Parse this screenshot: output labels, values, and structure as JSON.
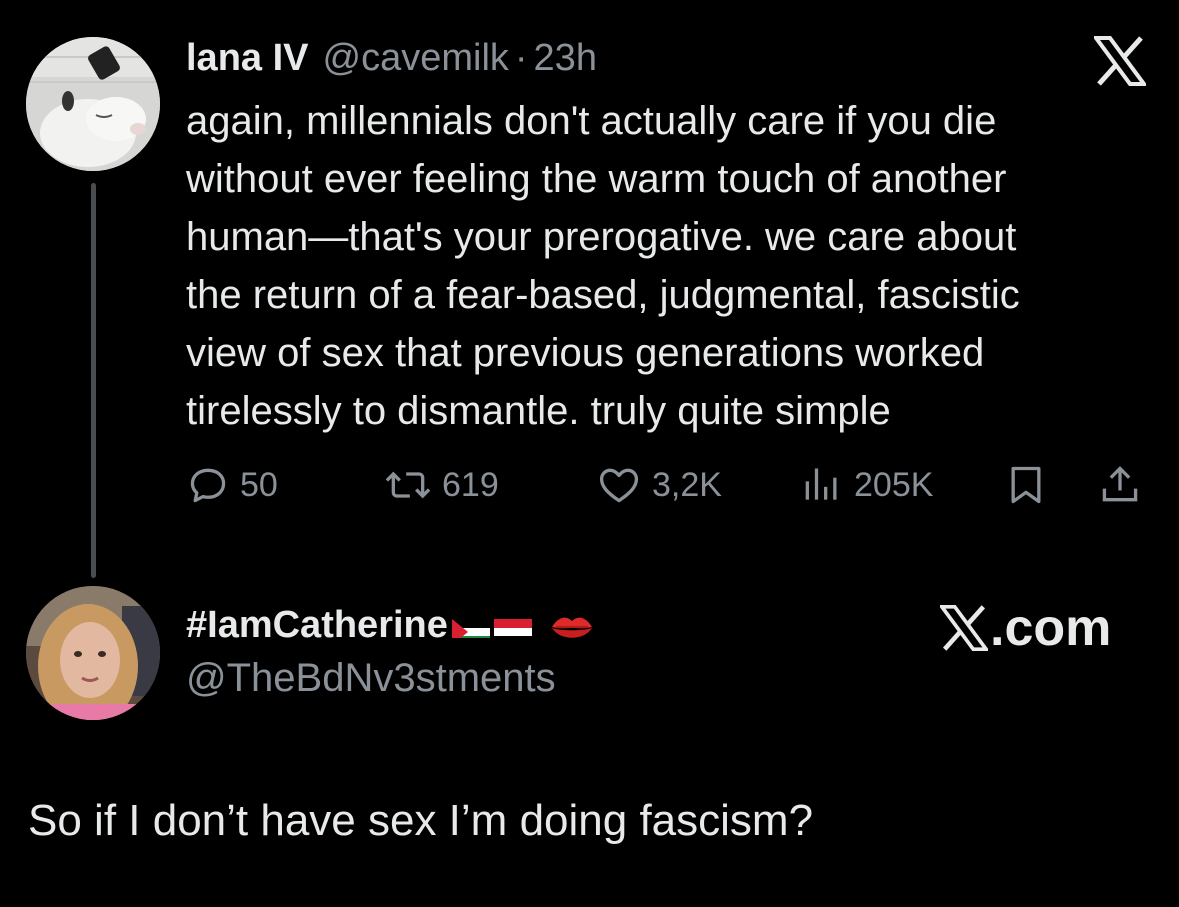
{
  "tweet1": {
    "display_name": "lana IV",
    "handle": "@cavemilk",
    "separator": "·",
    "time": "23h",
    "text": "again, millennials don't actually care if you die\nwithout ever feeling the warm touch of another\nhuman—that's your prerogative. we care about\nthe return of a fear-based, judgmental, fascistic\nview of sex that previous generations worked\ntirelessly to dismantle. truly quite simple",
    "avatar_icon": "goat-avatar",
    "actions": {
      "replies": "50",
      "reposts": "619",
      "likes": "3,2K",
      "views": "205K"
    }
  },
  "tweet2": {
    "display_name": "#IamCatherine",
    "handle": "@TheBdNv3stments",
    "flags": [
      "palestine-flag",
      "yemen-flag"
    ],
    "emoji": "kiss-mark-icon",
    "text": "So if I don’t have sex I’m doing fascism?",
    "avatar_icon": "woman-avatar"
  },
  "branding": {
    "x_logo": "x-logo-icon",
    "site_label": ".com"
  },
  "colors": {
    "background": "#000000",
    "primary_text": "#e7e9ea",
    "secondary_text": "#8b9198",
    "thread_line": "#4a4d50"
  }
}
